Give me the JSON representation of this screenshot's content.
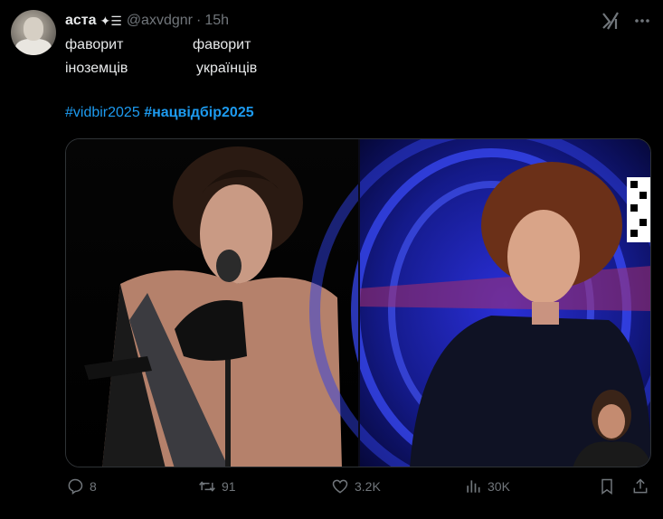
{
  "tweet": {
    "author_name": "аста",
    "author_emoji": "✦☰",
    "handle": "@axvdgnr",
    "separator": "·",
    "time": "15h",
    "lines": [
      {
        "left": "фаворит",
        "right": "фаворит"
      },
      {
        "left": "іноземців",
        "right": "українців"
      }
    ],
    "hashtag_1": "#vidbir2025",
    "hashtag_2": "#нацвідбір2025"
  },
  "metrics": {
    "replies": "8",
    "reposts": "91",
    "likes": "3.2K",
    "views": "30K"
  },
  "icons": {
    "grok": "grok-icon",
    "more": "more-icon",
    "reply": "reply-icon",
    "repost": "repost-icon",
    "like": "like-icon",
    "views": "views-icon",
    "bookmark": "bookmark-icon",
    "share": "share-icon"
  },
  "colors": {
    "background": "#000000",
    "text": "#e7e9ea",
    "muted": "#71767b",
    "link": "#1d9bf0"
  }
}
